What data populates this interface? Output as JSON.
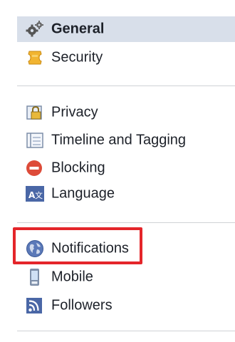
{
  "sidebar": {
    "groups": [
      {
        "items": [
          {
            "label": "General",
            "icon": "gears-icon",
            "active": true
          },
          {
            "label": "Security",
            "icon": "badge-icon",
            "active": false
          }
        ]
      },
      {
        "items": [
          {
            "label": "Privacy",
            "icon": "lock-icon",
            "active": false
          },
          {
            "label": "Timeline and Tagging",
            "icon": "timeline-icon",
            "active": false
          },
          {
            "label": "Blocking",
            "icon": "block-icon",
            "active": false
          },
          {
            "label": "Language",
            "icon": "language-icon",
            "active": false
          }
        ]
      },
      {
        "items": [
          {
            "label": "Notifications",
            "icon": "globe-icon",
            "active": false,
            "highlighted": true
          },
          {
            "label": "Mobile",
            "icon": "phone-icon",
            "active": false
          },
          {
            "label": "Followers",
            "icon": "rss-icon",
            "active": false
          }
        ]
      }
    ]
  },
  "colors": {
    "active_background": "#d8dfea",
    "highlight_outline": "#e4252a",
    "divider": "#cfd2d6",
    "text": "#1d2129"
  }
}
